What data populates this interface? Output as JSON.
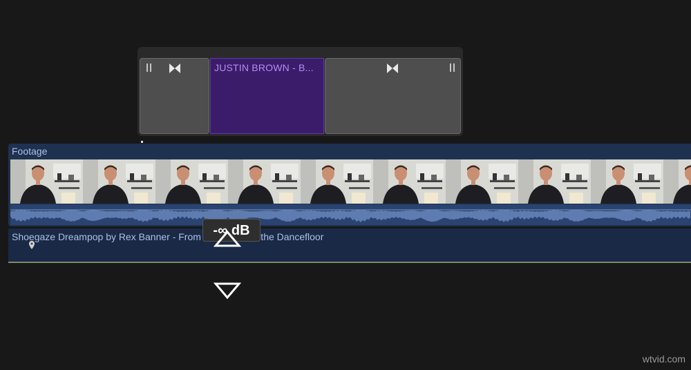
{
  "title_clip": {
    "label": "JUSTIN BROWN - B...",
    "purple": "#3b1c6b",
    "label_color": "#b48cf0"
  },
  "icons": {
    "left_pause": "pause-icon",
    "left_transition": "bowtie-transition-icon",
    "right_transition": "bowtie-transition-icon",
    "right_pause": "pause-icon"
  },
  "primary": {
    "label": "Footage",
    "thumbnail_count": 10,
    "color": "#1f3150"
  },
  "music": {
    "label": "Shoegaze Dreampop by Rex Banner - From the Beach to the Dancefloor"
  },
  "volume": {
    "tooltip": "-∞ dB"
  },
  "watermark": "wtvid.com"
}
